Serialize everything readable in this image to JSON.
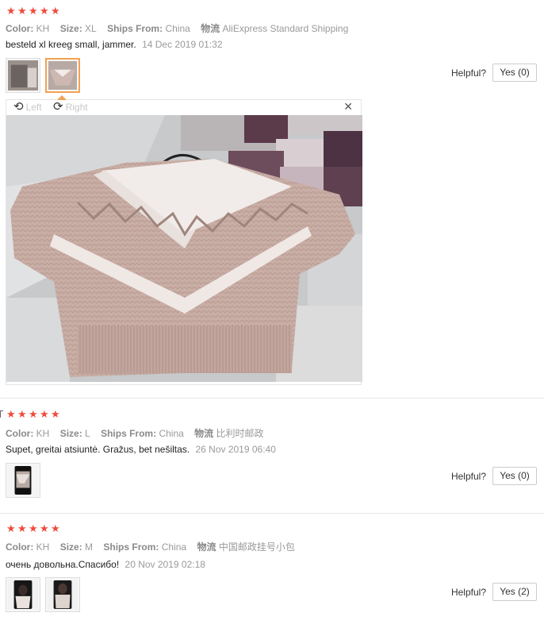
{
  "reviews": [
    {
      "stars": 5,
      "color_key": "Color:",
      "color_val": "KH",
      "size_key": "Size:",
      "size_val": "XL",
      "ships_key": "Ships From:",
      "ships_val": "China",
      "logistics_key": "物流",
      "logistics_val": "AliExpress Standard Shipping",
      "comment": "besteld xl kreeg small, jammer.",
      "date": "14 Dec 2019 01:32",
      "helpful_label": "Helpful?",
      "yes_label": "Yes (0)"
    },
    {
      "stars": 5,
      "color_key": "Color:",
      "color_val": "KH",
      "size_key": "Size:",
      "size_val": "L",
      "ships_key": "Ships From:",
      "ships_val": "China",
      "logistics_key": "物流",
      "logistics_val": "比利时邮政",
      "comment": "Supet, greitai atsiuntė. Gražus, bet nešiltas.",
      "date": "26 Nov 2019 06:40",
      "helpful_label": "Helpful?",
      "yes_label": "Yes (0)"
    },
    {
      "stars": 5,
      "color_key": "Color:",
      "color_val": "KH",
      "size_key": "Size:",
      "size_val": "M",
      "ships_key": "Ships From:",
      "ships_val": "China",
      "logistics_key": "物流",
      "logistics_val": "中国邮政挂号小包",
      "comment": "очень довольна.Спасибо!",
      "date": "20 Nov 2019 02:18",
      "helpful_label": "Helpful?",
      "yes_label": "Yes (2)"
    }
  ],
  "viewer": {
    "rotate_left": "Left",
    "rotate_right": "Right",
    "close_icon": "close-icon"
  },
  "colors": {
    "star": "#f04a3a",
    "active_thumb_border": "#f3a253",
    "label": "#8a8a8a"
  }
}
